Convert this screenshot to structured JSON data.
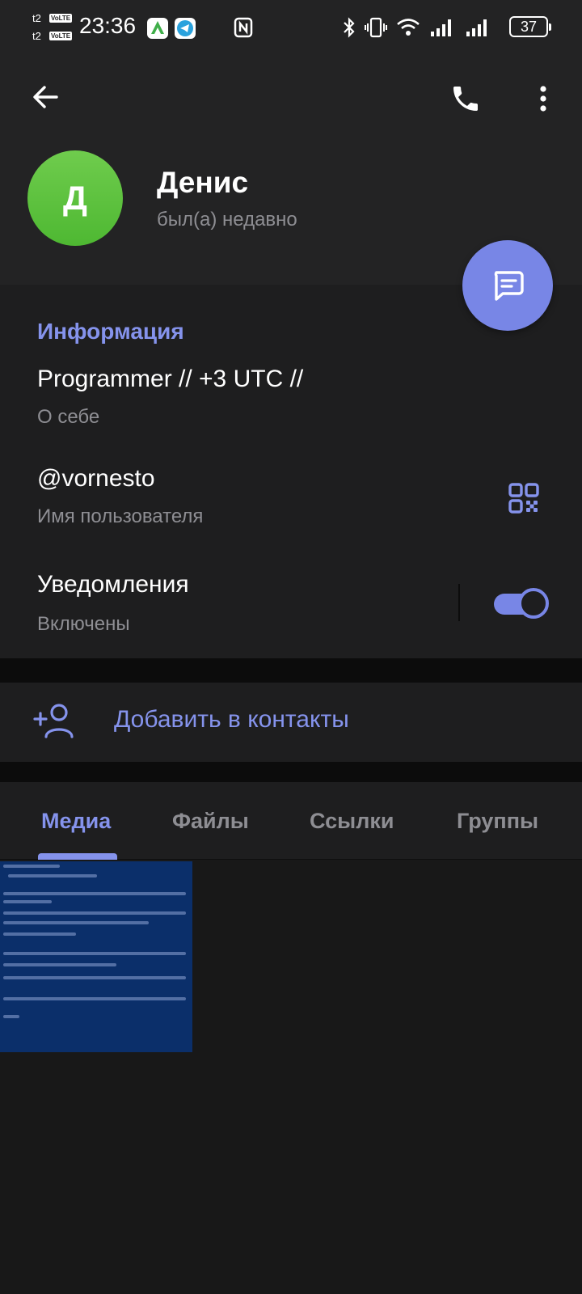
{
  "status_bar": {
    "sim1_label": "t2",
    "sim2_label": "t2",
    "volte": "VoLTE",
    "time": "23:36",
    "battery": "37",
    "app_icons": [
      "android-app-icon",
      "telegram-icon"
    ],
    "right_icons": [
      "nfc-icon",
      "bluetooth-icon",
      "vibrate-icon",
      "wifi-icon",
      "signal-icon",
      "signal-icon"
    ]
  },
  "toolbar": {
    "back_icon": "arrow-left-icon",
    "call_icon": "phone-icon",
    "menu_icon": "more-vertical-icon"
  },
  "profile": {
    "avatar_letter": "Д",
    "name": "Денис",
    "status": "был(а) недавно",
    "avatar_color": "#5cc23f"
  },
  "info": {
    "title": "Информация",
    "bio": "Programmer // +3 UTC //",
    "bio_label": "О себе",
    "username": "@vornesto",
    "username_label": "Имя пользователя",
    "notifications": "Уведомления",
    "notifications_state": "Включены",
    "notifications_enabled": true
  },
  "actions": {
    "add_contact": "Добавить в контакты"
  },
  "tabs": [
    {
      "label": "Медиа",
      "active": true
    },
    {
      "label": "Файлы",
      "active": false
    },
    {
      "label": "Ссылки",
      "active": false
    },
    {
      "label": "Группы",
      "active": false
    }
  ],
  "colors": {
    "accent": "#8593ec",
    "fab": "#7886e6",
    "header_bg": "#232324",
    "card_bg": "#1e1e1f",
    "page_bg": "#181818"
  }
}
